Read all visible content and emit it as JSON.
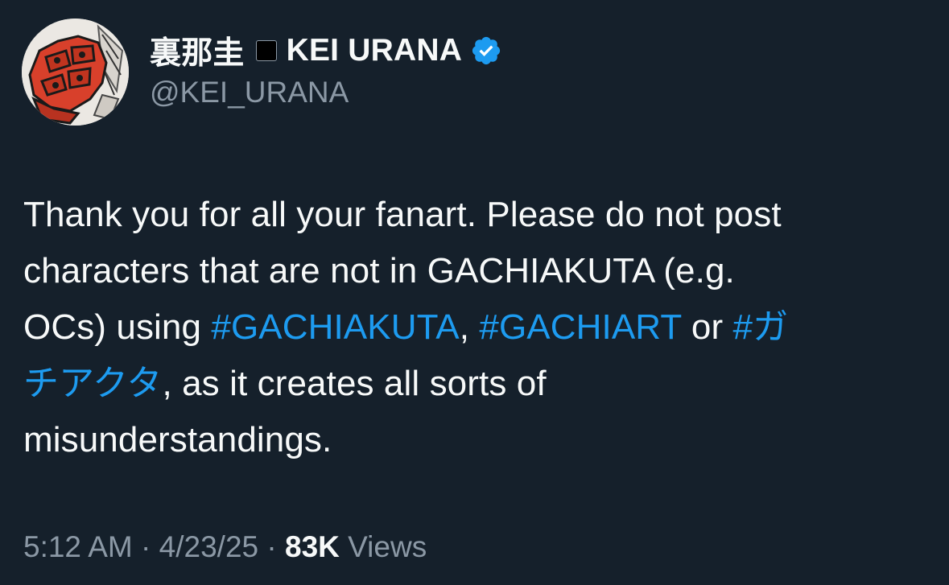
{
  "author": {
    "display_name_jp": "裏那圭",
    "display_name_en": "KEI URANA",
    "handle": "@KEI_URANA",
    "verified": true,
    "avatar_icon": "manga-character-avatar",
    "verified_icon": "verified-badge-icon"
  },
  "tweet": {
    "line1": "Thank you for all your fanart. Please do not post",
    "line2": "characters that are not in GACHIAKUTA (e.g.",
    "line3_prefix": "OCs) using ",
    "hashtag1": "#GACHIAKUTA",
    "sep1": ", ",
    "hashtag2": "#GACHIART",
    "sep2": " or ",
    "hashtag3_part1": "#ガ",
    "hashtag3_part2": "チアクタ",
    "line4_suffix": ", as it creates all sorts of",
    "line5": "misunderstandings."
  },
  "meta": {
    "time": "5:12 AM",
    "dot1": " · ",
    "date": "4/23/25",
    "dot2": " · ",
    "views_count": "83K",
    "views_label": " Views"
  },
  "colors": {
    "background": "#15202b",
    "text": "#f7f9f9",
    "secondary": "#8b98a5",
    "link": "#1d9bf0"
  }
}
